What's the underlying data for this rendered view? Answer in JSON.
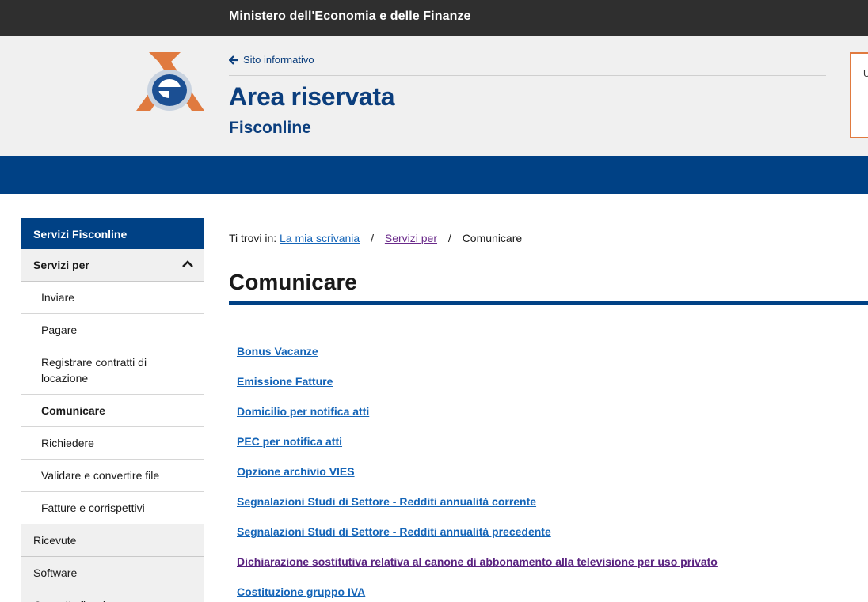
{
  "topbar": {
    "ministry": "Ministero dell'Economia e delle Finanze"
  },
  "header": {
    "back_link": "Sito informativo",
    "title": "Area riservata",
    "subtitle": "Fisconline",
    "user_box_letter": "U"
  },
  "sidebar": {
    "heading": "Servizi Fisconline",
    "group": "Servizi per",
    "items": [
      "Inviare",
      "Pagare",
      "Registrare contratti di locazione",
      "Comunicare",
      "Richiedere",
      "Validare e convertire file",
      "Fatture e corrispettivi"
    ],
    "top_items": [
      "Ricevute",
      "Software",
      "Cassetto fiscale"
    ]
  },
  "breadcrumb": {
    "prefix": "Ti trovi in:",
    "crumbs": [
      "La mia scrivania",
      "Servizi per"
    ],
    "current": "Comunicare",
    "separator": "/"
  },
  "main": {
    "title": "Comunicare",
    "links": [
      "Bonus Vacanze",
      "Emissione Fatture",
      "Domicilio per notifica atti",
      "PEC per notifica atti",
      "Opzione archivio VIES",
      "Segnalazioni Studi di Settore - Redditi annualità corrente",
      "Segnalazioni Studi di Settore - Redditi annualità precedente",
      "Dichiarazione sostitutiva relativa al canone di abbonamento alla televisione per uso privato",
      "Costituzione gruppo IVA"
    ]
  },
  "colors": {
    "brand_blue": "#004185",
    "link_blue": "#1565b8",
    "visited_purple": "#5a2380",
    "logo_orange": "#e07a3f"
  }
}
